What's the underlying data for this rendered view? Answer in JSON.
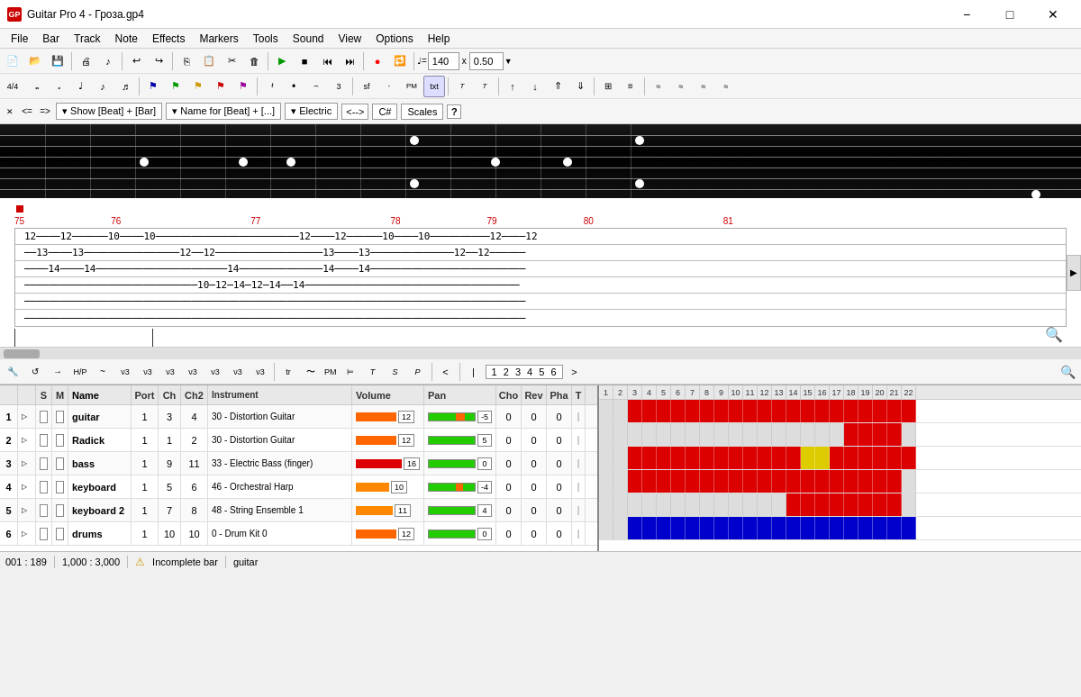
{
  "window": {
    "title": "Guitar Pro 4 - Гроза.gp4",
    "minimize": "−",
    "maximize": "□",
    "close": "✕"
  },
  "menubar": {
    "items": [
      "File",
      "Bar",
      "Track",
      "Note",
      "Effects",
      "Markers",
      "Tools",
      "Sound",
      "View",
      "Options",
      "Help"
    ]
  },
  "toolbar1": {
    "tempo_label": "♩=",
    "tempo_value": "140",
    "x_label": "x",
    "speed_value": "0.50"
  },
  "fretboard_bar": {
    "less": "<",
    "equals": "=",
    "greater": ">",
    "show_label": "Show [Beat] + [Bar]",
    "name_label": "Name for [Beat] + [...]",
    "instrument": "Electric",
    "arrows": "<-->",
    "key": "C#",
    "scales": "Scales"
  },
  "score": {
    "measures": [
      "75",
      "76",
      "77",
      "78",
      "79",
      "80",
      "81"
    ],
    "lines": [
      "12────12──────10──────10──────────────12────12──────10──────10────────12────12",
      "──13────13────────────────12──12──────────13────13──────────────12──12────────",
      "────14────14──────────────────────14────────14────14──────────────────────────",
      "──────────────────────────────────────────────────────────────────────────────",
      "──────────────────────────────────────────────────────────────────────────────",
      "──────────────────────────────────────────────────────────────────────────────"
    ]
  },
  "tracks": {
    "header": {
      "nav": "< >",
      "solo": "S",
      "mute": "M",
      "name": "Name",
      "port": "Port",
      "ch": "Ch",
      "ch2": "Ch2",
      "instrument": "Instrument",
      "volume": "Volume",
      "pan": "Pan",
      "cho": "Cho",
      "rev": "Rev",
      "pha": "Pha",
      "t": "T"
    },
    "rows": [
      {
        "num": "1",
        "name": "guitar",
        "port": "1",
        "ch": "3",
        "ch2": "4",
        "instrument": "30 - Distortion Guitar",
        "volume": "12",
        "pan": "-5",
        "cho": "0",
        "rev": "0",
        "pha": "0",
        "vol_pct": 75,
        "pan_neg": true
      },
      {
        "num": "2",
        "name": "Radick",
        "port": "1",
        "ch": "1",
        "ch2": "2",
        "instrument": "30 - Distortion Guitar",
        "volume": "12",
        "pan": "5",
        "cho": "0",
        "rev": "0",
        "pha": "0",
        "vol_pct": 75,
        "pan_neg": false
      },
      {
        "num": "3",
        "name": "bass",
        "port": "1",
        "ch": "9",
        "ch2": "11",
        "instrument": "33 - Electric Bass (finger)",
        "volume": "16",
        "pan": "0",
        "cho": "0",
        "rev": "0",
        "pha": "0",
        "vol_pct": 85,
        "pan_neg": false
      },
      {
        "num": "4",
        "name": "keyboard",
        "port": "1",
        "ch": "5",
        "ch2": "6",
        "instrument": "46 - Orchestral Harp",
        "volume": "10",
        "pan": "-4",
        "cho": "0",
        "rev": "0",
        "pha": "0",
        "vol_pct": 62,
        "pan_neg": true
      },
      {
        "num": "5",
        "name": "keyboard 2",
        "port": "1",
        "ch": "7",
        "ch2": "8",
        "instrument": "48 - String Ensemble 1",
        "volume": "11",
        "pan": "4",
        "cho": "0",
        "rev": "0",
        "pha": "0",
        "vol_pct": 68,
        "pan_neg": false
      },
      {
        "num": "6",
        "name": "drums",
        "port": "1",
        "ch": "10",
        "ch2": "10",
        "instrument": "0 - Drum Kit 0",
        "volume": "12",
        "pan": "0",
        "cho": "0",
        "rev": "0",
        "pha": "0",
        "vol_pct": 75,
        "pan_neg": false
      }
    ]
  },
  "patterns": {
    "numbers": [
      1,
      2,
      3,
      4,
      5,
      6,
      7,
      8,
      9,
      10,
      11,
      12,
      13,
      14,
      15,
      16,
      17,
      18,
      19,
      20,
      21,
      22
    ],
    "rows": [
      [
        0,
        0,
        1,
        1,
        1,
        1,
        1,
        1,
        1,
        1,
        1,
        1,
        1,
        1,
        1,
        1,
        1,
        1,
        1,
        1,
        1,
        1
      ],
      [
        0,
        0,
        0,
        0,
        0,
        0,
        0,
        0,
        0,
        0,
        0,
        0,
        0,
        0,
        0,
        0,
        0,
        1,
        1,
        1,
        1,
        0
      ],
      [
        0,
        0,
        1,
        1,
        1,
        1,
        1,
        1,
        1,
        1,
        1,
        1,
        1,
        1,
        3,
        3,
        1,
        1,
        1,
        1,
        1,
        1
      ],
      [
        0,
        0,
        1,
        1,
        1,
        1,
        1,
        1,
        1,
        1,
        1,
        1,
        1,
        1,
        1,
        1,
        1,
        1,
        1,
        1,
        1,
        0
      ],
      [
        0,
        0,
        0,
        0,
        0,
        0,
        0,
        0,
        0,
        0,
        0,
        0,
        0,
        1,
        1,
        1,
        1,
        1,
        1,
        1,
        1,
        0
      ],
      [
        0,
        0,
        2,
        2,
        2,
        2,
        2,
        2,
        2,
        2,
        2,
        2,
        2,
        2,
        2,
        2,
        2,
        2,
        2,
        2,
        2,
        2
      ]
    ]
  },
  "statusbar": {
    "position": "001 : 189",
    "time": "1,000 : 3,000",
    "warning": "Incomplete bar",
    "track": "guitar"
  }
}
